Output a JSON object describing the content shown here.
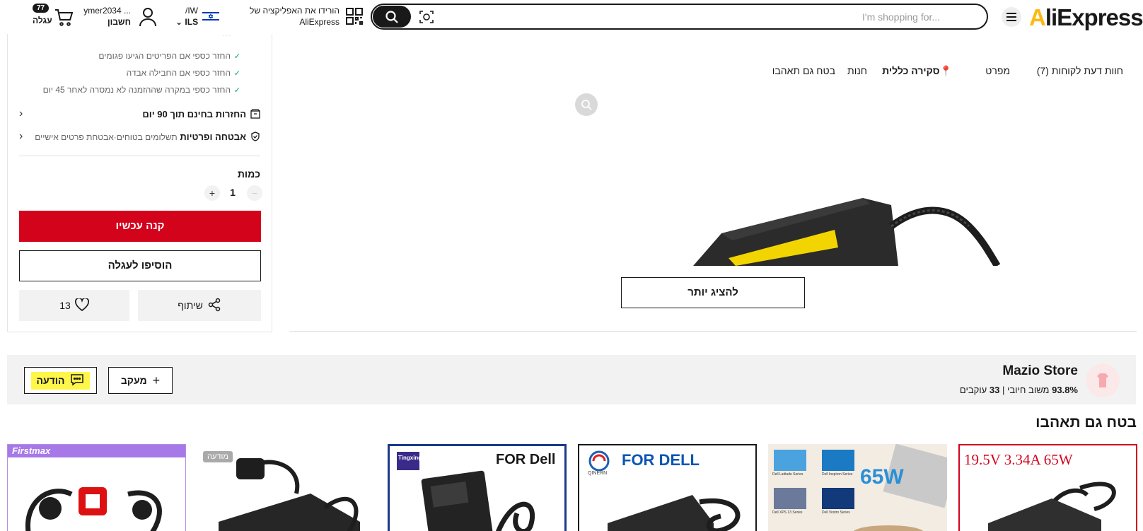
{
  "header": {
    "logo": "AliExpress",
    "search_placeholder": "I'm shopping for...",
    "app_download_line1": "הורידו את האפליקציה של",
    "app_download_line2": "AliExpress",
    "locale_lang": "/IW",
    "locale_currency": "ILS",
    "account_name": "ymer2034 ...",
    "account_label": "חשבון",
    "cart_count": "77",
    "cart_label": "עגלה"
  },
  "buy_panel": {
    "guarantees": [
      "החזר כספי אם הפריטים הגיעו פגומים",
      "החזר כספי אם החבילה אבדה",
      "החזר כספי במקרה שההזמנה לא נמסרה לאחר 45 יום"
    ],
    "free_returns": "החזרות בחינם תוך 90 יום",
    "security_title": "אבטחה ופרטיות",
    "security_sub": "תשלומים בטוחים·אבטחת פרטים אישיים",
    "quantity_label": "כמות",
    "quantity_value": "1",
    "buy_now": "קנה עכשיו",
    "add_to_cart": "הוסיפו לעגלה",
    "share": "שיתוף",
    "wishlist_count": "13"
  },
  "tabs": [
    {
      "label": "חוות דעת לקוחות (7)"
    },
    {
      "label": "מפרט"
    },
    {
      "label": "סקירה כללית"
    },
    {
      "label": "חנות"
    },
    {
      "label": "בטח גם תאהבו"
    }
  ],
  "product": {
    "show_more": "להציג יותר"
  },
  "store": {
    "name": "Mazio Store",
    "rating": "93.8%",
    "rating_label": "משוב חיובי",
    "followers": "33",
    "followers_label": "עוקבים",
    "follow": "מעקב",
    "message": "הודעה"
  },
  "recommendations": {
    "title": "בטח גם תאהבו",
    "ad_label": "מודעה",
    "cards": [
      {
        "brand": "Firstmax"
      },
      {
        "brand": ""
      },
      {
        "brand": "Tingxing",
        "caption": "FOR Dell"
      },
      {
        "brand": "QINERN",
        "caption": "FOR DELL"
      },
      {
        "caption": "65W",
        "labels": [
          "Dell Latitude Series",
          "Dell Inspiron Series",
          "Dell XPS 13 Series",
          "Dell Vostro Series"
        ]
      },
      {
        "caption": "19.5V 3.34A 65W"
      }
    ]
  },
  "colors": {
    "accent_red": "#d3031c",
    "check_green": "#00a650",
    "highlight_yellow": "#fff64a"
  }
}
